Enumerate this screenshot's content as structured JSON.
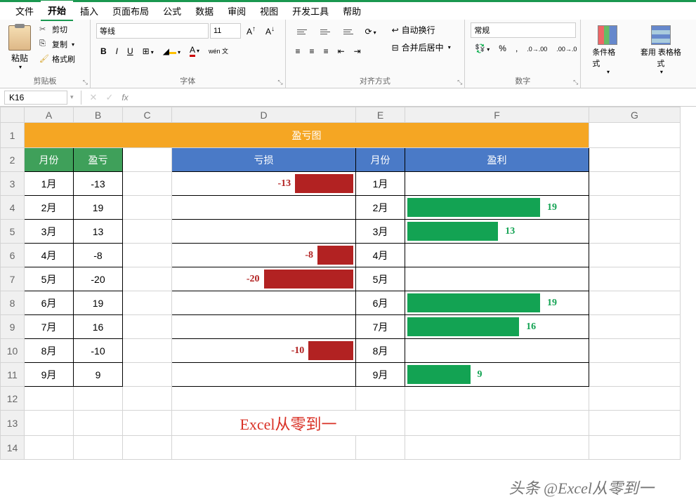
{
  "menu": {
    "items": [
      "文件",
      "开始",
      "插入",
      "页面布局",
      "公式",
      "数据",
      "审阅",
      "视图",
      "开发工具",
      "帮助"
    ],
    "active_index": 1
  },
  "ribbon": {
    "clipboard": {
      "label": "剪贴板",
      "paste": "粘贴",
      "cut": "剪切",
      "copy": "复制",
      "format_painter": "格式刷"
    },
    "font": {
      "label": "字体",
      "family": "等线",
      "size": "11",
      "bold": "B",
      "italic": "I",
      "underline": "U",
      "wen": "wén 文"
    },
    "align": {
      "label": "对齐方式",
      "wrap": "自动换行",
      "merge": "合并后居中"
    },
    "number": {
      "label": "数字",
      "format": "常规"
    },
    "styles": {
      "cond_fmt": "条件格式",
      "table_fmt": "套用 表格格式"
    }
  },
  "name_box": "K16",
  "columns": [
    "A",
    "B",
    "C",
    "D",
    "E",
    "F",
    "G"
  ],
  "title": "盈亏图",
  "headers": {
    "month": "月份",
    "pl": "盈亏",
    "loss": "亏损",
    "profit": "盈利"
  },
  "chart_data": {
    "type": "bar",
    "categories": [
      "1月",
      "2月",
      "3月",
      "4月",
      "5月",
      "6月",
      "7月",
      "8月",
      "9月"
    ],
    "values": [
      -13,
      19,
      13,
      -8,
      -20,
      19,
      16,
      -10,
      9
    ],
    "max_abs": 20,
    "title": "盈亏图"
  },
  "rows": [
    {
      "month": "1月",
      "pl": "-13",
      "loss": -13,
      "profit": null
    },
    {
      "month": "2月",
      "pl": "19",
      "loss": null,
      "profit": 19
    },
    {
      "month": "3月",
      "pl": "13",
      "loss": null,
      "profit": 13
    },
    {
      "month": "4月",
      "pl": "-8",
      "loss": -8,
      "profit": null
    },
    {
      "month": "5月",
      "pl": "-20",
      "loss": -20,
      "profit": null
    },
    {
      "month": "6月",
      "pl": "19",
      "loss": null,
      "profit": 19
    },
    {
      "month": "7月",
      "pl": "16",
      "loss": null,
      "profit": 16
    },
    {
      "month": "8月",
      "pl": "-10",
      "loss": -10,
      "profit": null
    },
    {
      "month": "9月",
      "pl": "9",
      "loss": null,
      "profit": 9
    }
  ],
  "watermark1": "Excel从零到一",
  "watermark2": "头条 @Excel从零到一"
}
